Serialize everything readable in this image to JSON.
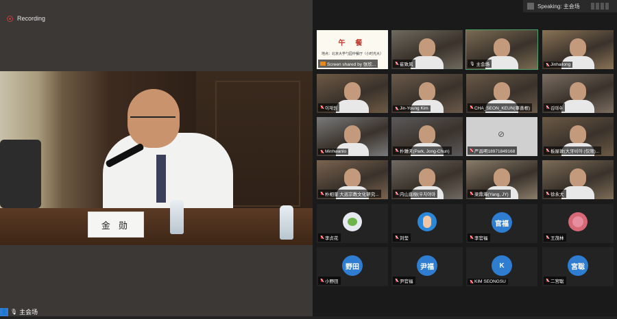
{
  "recording": {
    "label": "Recording"
  },
  "speaker_bar": {
    "label": "Speaking: 主会场"
  },
  "main_video": {
    "name_plate": "金 勋",
    "participant_label": "主会场"
  },
  "colors": {
    "active_border": "#4aa36c",
    "mute_icon": "#e23",
    "avatar_blue": "#2f7dd1",
    "share_icon": "#e88a1a"
  },
  "tiles": [
    {
      "kind": "slide",
      "name": "Screen shared by 张欣...",
      "slide_title": "午 餐",
      "slide_sub": "地点：北京大学勺园中餐厅（小时光大）",
      "icon": "share"
    },
    {
      "kind": "video",
      "name": "崔致风",
      "icon": "mute",
      "bg": "#6f6a5e"
    },
    {
      "kind": "video",
      "name": "主会场",
      "icon": "user",
      "bg": "#7a6b52",
      "active": true
    },
    {
      "kind": "video",
      "name": "Jinhailong",
      "icon": "mute",
      "bg": "#8a7356"
    },
    {
      "kind": "video",
      "name": "이재원",
      "icon": "mute",
      "bg": "#6e5a45"
    },
    {
      "kind": "video",
      "name": "Jin-Young Kim",
      "icon": "mute",
      "bg": "#6b5a4b"
    },
    {
      "kind": "video",
      "name": "CHA_SEON_KEUN(車善根)",
      "icon": "mute",
      "bg": "#6a5a48"
    },
    {
      "kind": "video",
      "name": "김태수",
      "icon": "mute",
      "bg": "#7b6e62"
    },
    {
      "kind": "video",
      "name": "Minhwanlo",
      "icon": "mute",
      "bg": "#7a7b7c"
    },
    {
      "kind": "video",
      "name": "朴鍾天(Park, Jong-Chun)",
      "icon": "mute",
      "bg": "#5b5a5b"
    },
    {
      "kind": "camoff",
      "name": "严昌明18971849168",
      "icon": "mute",
      "bg": "#d0d0d0"
    },
    {
      "kind": "video",
      "name": "板屋敦(大牙비야 (仅限)...",
      "icon": "mute",
      "bg": "#6b5a45"
    },
    {
      "kind": "video",
      "name": "朴相奎 大巡宗教文化研究...",
      "icon": "mute",
      "bg": "#7b6450"
    },
    {
      "kind": "video",
      "name": "内山直樹(우치야마",
      "icon": "mute",
      "bg": "#6f6a62"
    },
    {
      "kind": "video",
      "name": "梁鼎海(Yang, JY)",
      "icon": "mute",
      "bg": "#8a7d6a"
    },
    {
      "kind": "video",
      "name": "徐永大",
      "icon": "mute",
      "bg": "#7d6d58"
    },
    {
      "kind": "avatar",
      "name": "李贞花",
      "icon": "mute",
      "avatar_bg": "#e6eaf0",
      "picture": "flower"
    },
    {
      "kind": "avatar",
      "name": "刘莹",
      "icon": "mute",
      "avatar_bg": "#2b87d8",
      "picture": "girl"
    },
    {
      "kind": "avatar",
      "name": "李官福",
      "icon": "mute",
      "avatar_text": "官福",
      "avatar_bg": "#2f7dd1"
    },
    {
      "kind": "avatar",
      "name": "王茂林",
      "icon": "mute",
      "avatar_bg": "#d56a76",
      "picture": "bear"
    },
    {
      "kind": "avatar",
      "name": "小野田",
      "icon": "mute",
      "avatar_text": "野田",
      "avatar_bg": "#2f7dd1"
    },
    {
      "kind": "avatar",
      "name": "尹官福",
      "icon": "mute",
      "avatar_text": "尹福",
      "avatar_bg": "#2f7dd1"
    },
    {
      "kind": "avatar",
      "name": "KIM SEONGSU",
      "icon": "mute",
      "avatar_text": "K",
      "avatar_bg": "#2f7dd1"
    },
    {
      "kind": "avatar",
      "name": "二宮聡",
      "icon": "mute",
      "avatar_text": "宮聡",
      "avatar_bg": "#2f7dd1"
    }
  ]
}
